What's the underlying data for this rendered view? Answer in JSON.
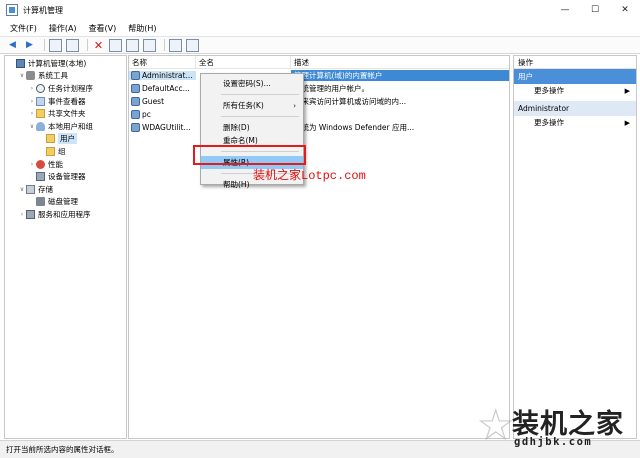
{
  "window": {
    "title": "计算机管理",
    "controls": [
      "—",
      "☐",
      "✕"
    ]
  },
  "menu": [
    "文件(F)",
    "操作(A)",
    "查看(V)",
    "帮助(H)"
  ],
  "tree": [
    {
      "label": "计算机管理(本地)",
      "level": 0,
      "expander": "",
      "icon": "computer-icon"
    },
    {
      "label": "系统工具",
      "level": 1,
      "expander": "∨",
      "icon": "tools-icon"
    },
    {
      "label": "任务计划程序",
      "level": 2,
      "expander": "›",
      "icon": "clock-icon"
    },
    {
      "label": "事件查看器",
      "level": 2,
      "expander": "›",
      "icon": "event-viewer-icon"
    },
    {
      "label": "共享文件夹",
      "level": 2,
      "expander": "›",
      "icon": "shared-folder-icon"
    },
    {
      "label": "本地用户和组",
      "level": 2,
      "expander": "∨",
      "icon": "users-icon"
    },
    {
      "label": "用户",
      "level": 3,
      "expander": "",
      "icon": "folder-icon",
      "selected": true
    },
    {
      "label": "组",
      "level": 3,
      "expander": "",
      "icon": "folder-icon"
    },
    {
      "label": "性能",
      "level": 2,
      "expander": "›",
      "icon": "performance-icon"
    },
    {
      "label": "设备管理器",
      "level": 2,
      "expander": "",
      "icon": "device-manager-icon"
    },
    {
      "label": "存储",
      "level": 1,
      "expander": "∨",
      "icon": "storage-icon"
    },
    {
      "label": "磁盘管理",
      "level": 2,
      "expander": "",
      "icon": "disk-icon"
    },
    {
      "label": "服务和应用程序",
      "level": 1,
      "expander": "›",
      "icon": "services-icon"
    }
  ],
  "list": {
    "columns": [
      "名称",
      "全名",
      "描述"
    ],
    "rows": [
      {
        "name": "Administrat...",
        "fullname": "",
        "desc": "管理计算机(域)的内置帐户"
      },
      {
        "name": "DefaultAcc...",
        "fullname": "",
        "desc": "系统管理的用户帐户。"
      },
      {
        "name": "Guest",
        "fullname": "",
        "desc": "供来宾访问计算机或访问域的内..."
      },
      {
        "name": "pc",
        "fullname": "",
        "desc": ""
      },
      {
        "name": "WDAGUtilit...",
        "fullname": "",
        "desc": "系统为 Windows Defender 应用..."
      }
    ]
  },
  "context_menu": {
    "set_password": "设置密码(S)...",
    "all_tasks": "所有任务(K)",
    "delete": "删除(D)",
    "rename": "重命名(M)",
    "properties": "属性(R)",
    "help": "帮助(H)"
  },
  "annotation": "装机之家Lotpc.com",
  "actions": {
    "title": "操作",
    "section1": "用户",
    "section1_item": "更多操作",
    "section2": "Administrator",
    "section2_item": "更多操作"
  },
  "status": "打开当前所选内容的属性对话框。",
  "watermark": {
    "big": "装机之家",
    "small": "gdhjbk.com"
  },
  "colors": {
    "highlight_border": "#e41b1b",
    "annotation": "#e40d0d",
    "selection": "#cce4f7",
    "action_header": "#4a8fd8"
  }
}
